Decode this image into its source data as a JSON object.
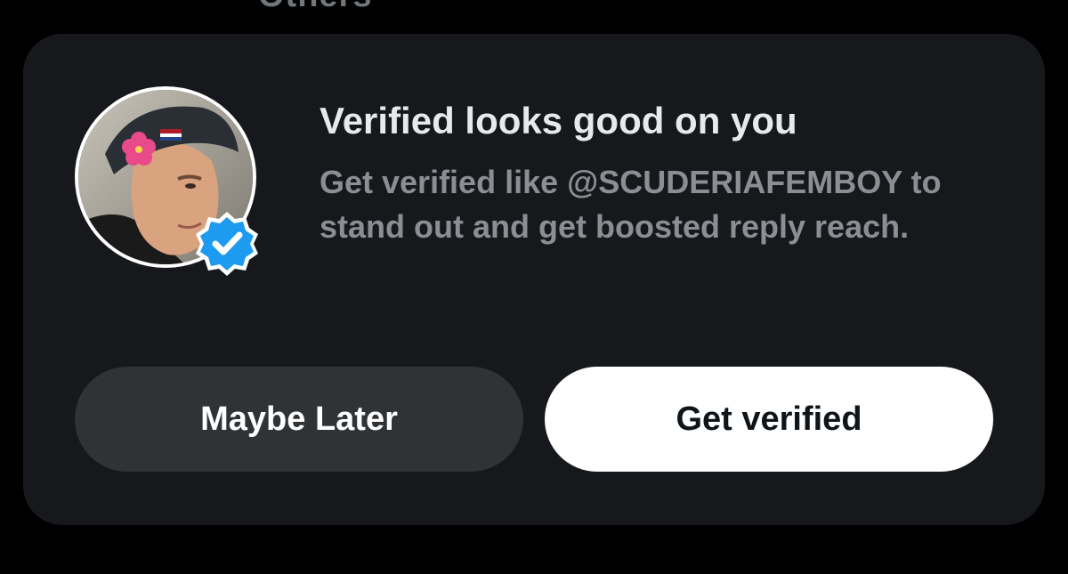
{
  "background_top_text": "Others",
  "promo": {
    "title": "Verified looks good on you",
    "subtitle": "Get verified like @SCUDERIAFEMBOY to stand out and get boosted reply reach.",
    "avatar": {
      "icon": "profile-photo",
      "badge_icon": "verified-badge-icon",
      "badge_color": "#1d9bf0"
    },
    "buttons": {
      "maybe_later": "Maybe Later",
      "get_verified": "Get verified"
    }
  },
  "colors": {
    "page_bg": "#000000",
    "card_bg": "#16181c",
    "secondary_button_bg": "#2f3336",
    "primary_button_bg": "#ffffff",
    "title_text": "#e7e9ea",
    "subtitle_text": "#8b8f94",
    "verified_blue": "#1d9bf0"
  }
}
